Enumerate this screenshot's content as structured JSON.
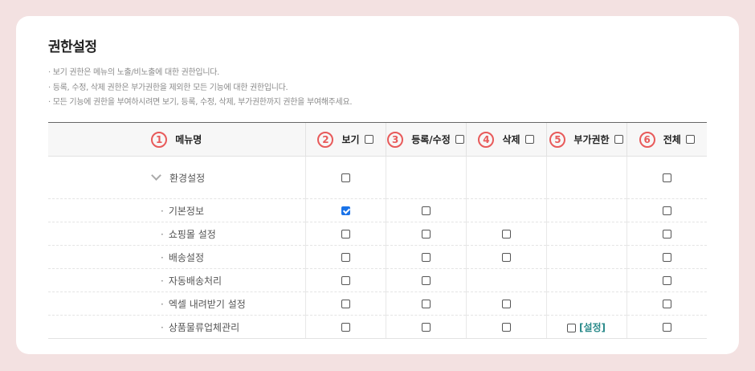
{
  "title": "권한설정",
  "notes": [
    "· 보기 권한은 메뉴의 노출/비노출에 대한 권한입니다.",
    "· 등록, 수정, 삭제 권한은 부가권한을 제외한 모든 기능에 대한 권한입니다.",
    "· 모든 기능에 권한을 부여하시려면 보기, 등록, 수정, 삭제, 부가권한까지 권한을 부여해주세요."
  ],
  "columns": [
    {
      "num": "1",
      "label": "메뉴명"
    },
    {
      "num": "2",
      "label": "보기"
    },
    {
      "num": "3",
      "label": "등록/수정"
    },
    {
      "num": "4",
      "label": "삭제"
    },
    {
      "num": "5",
      "label": "부가권한"
    },
    {
      "num": "6",
      "label": "전체"
    }
  ],
  "group": {
    "label": "환경설정"
  },
  "rows": [
    {
      "label": "기본정보"
    },
    {
      "label": "쇼핑몰 설정"
    },
    {
      "label": "배송설정"
    },
    {
      "label": "자동배송처리"
    },
    {
      "label": "엑셀 내려받기 설정"
    },
    {
      "label": "상품물류업체관리"
    }
  ],
  "setting_link": "[설정]",
  "bullet": "·"
}
